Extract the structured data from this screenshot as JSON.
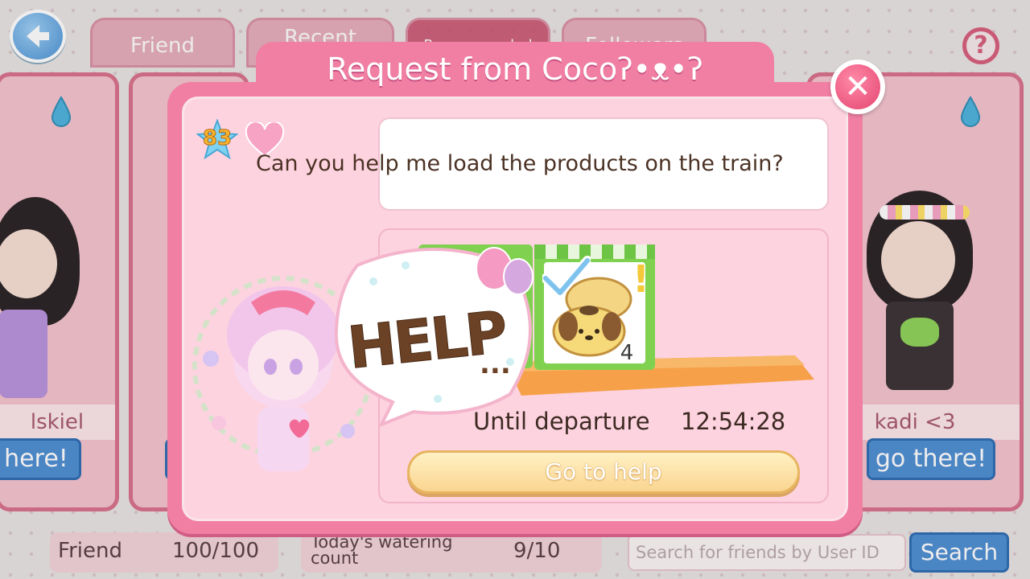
{
  "background": {
    "tabs": [
      {
        "label": "Friend",
        "active": false
      },
      {
        "label": "Recent",
        "active": false
      },
      {
        "label": "Recommended",
        "active": true
      },
      {
        "label": "Followers",
        "active": false
      }
    ],
    "cards": [
      {
        "name": "lskiel",
        "button": "here!"
      },
      {
        "name": "",
        "button": ""
      },
      {
        "name": "kadi <3",
        "button": "go there!"
      }
    ],
    "bottom": {
      "friend_label": "Friend",
      "friend_count": "100/100",
      "watering_label": "Today's watering count",
      "watering_count": "9/10",
      "search_placeholder": "Search for friends by User ID",
      "search_button": "Search"
    }
  },
  "modal": {
    "title": "Request from Cocoʔ•ᴥ•ʔ",
    "level": "83",
    "message": "Can you help me load the products on the train?",
    "help_stamp": "HELP",
    "help_dots": "...",
    "item_count": "4",
    "timer_label": "Until departure",
    "timer_value": "12:54:28",
    "action_button": "Go to help"
  },
  "colors": {
    "modal_frame": "#f07fa3",
    "modal_body": "#fdd3e0",
    "accent_blue": "#4e8fd3",
    "timer_text": "#3d2a22"
  },
  "icons": [
    "back-arrow-icon",
    "help-question-icon",
    "close-icon",
    "water-drop-icon",
    "level-star-icon",
    "heart-icon",
    "checkmark-icon",
    "exclamation-icon"
  ]
}
